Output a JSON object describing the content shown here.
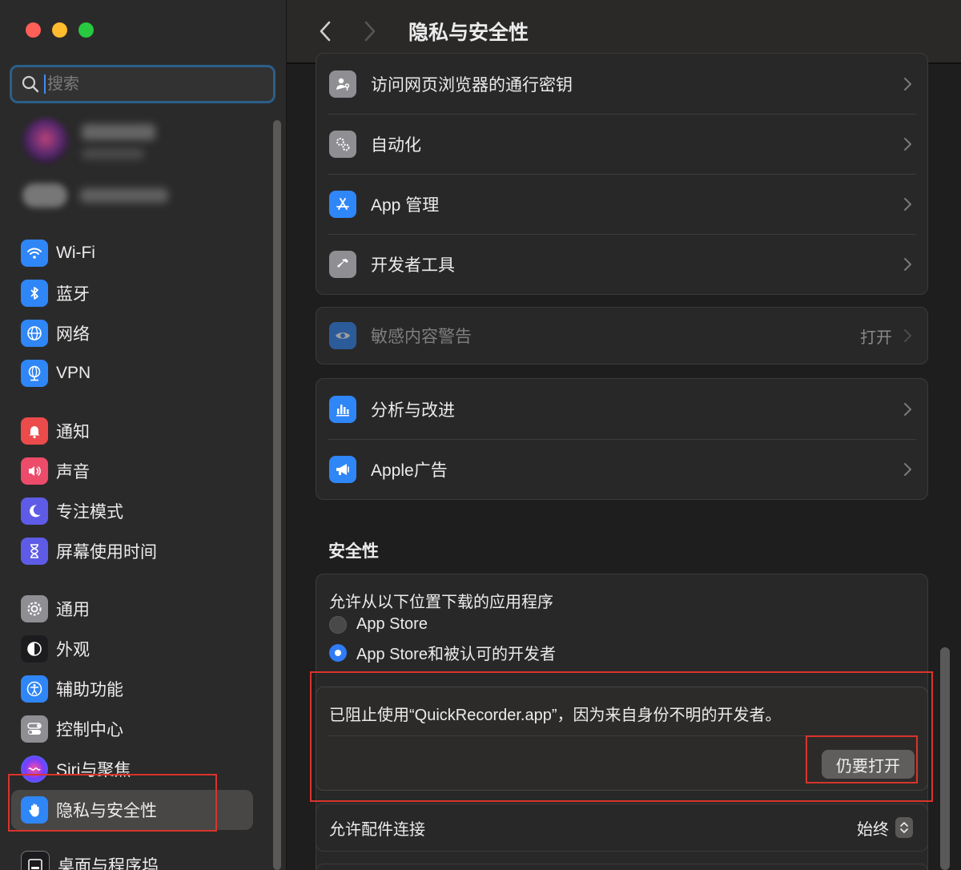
{
  "window": {
    "traffic_lights": {
      "close": "#ff5f57",
      "minimize": "#febc2e",
      "maximize": "#28c840"
    }
  },
  "sidebar": {
    "search": {
      "placeholder": "搜索",
      "icon": "magnifying-glass-icon"
    },
    "items": [
      {
        "label": "Wi-Fi",
        "icon": "wifi-icon",
        "color": "#2f86f6"
      },
      {
        "label": "蓝牙",
        "icon": "bluetooth-icon",
        "color": "#2f86f6"
      },
      {
        "label": "网络",
        "icon": "globe-icon",
        "color": "#2f86f6"
      },
      {
        "label": "VPN",
        "icon": "vpn-globe-icon",
        "color": "#2f86f6"
      },
      {
        "label": "通知",
        "icon": "bell-icon",
        "color": "#ec4b4b"
      },
      {
        "label": "声音",
        "icon": "speaker-icon",
        "color": "#ec4b6a"
      },
      {
        "label": "专注模式",
        "icon": "moon-icon",
        "color": "#5e5ce6"
      },
      {
        "label": "屏幕使用时间",
        "icon": "hourglass-icon",
        "color": "#5e5ce6"
      },
      {
        "label": "通用",
        "icon": "gear-icon",
        "color": "#8e8e93"
      },
      {
        "label": "外观",
        "icon": "appearance-icon",
        "color": "#1c1c1e"
      },
      {
        "label": "辅助功能",
        "icon": "accessibility-icon",
        "color": "#2f86f6"
      },
      {
        "label": "控制中心",
        "icon": "toggles-icon",
        "color": "#8e8e93"
      },
      {
        "label": "Siri与聚焦",
        "icon": "siri-icon",
        "color": "#7a3cff"
      },
      {
        "label": "隐私与安全性",
        "icon": "hand-icon",
        "color": "#2f86f6",
        "selected": true
      },
      {
        "label": "桌面与程序坞",
        "icon": "dock-icon",
        "color": "#1c1c1e"
      }
    ]
  },
  "main": {
    "title": "隐私与安全性",
    "group1": [
      {
        "label": "访问网页浏览器的通行密钥",
        "icon": "person-key-icon",
        "color": "#8e8e93"
      },
      {
        "label": "自动化",
        "icon": "gears-icon",
        "color": "#8e8e93"
      },
      {
        "label": "App 管理",
        "icon": "app-store-icon",
        "color": "#2f86f6"
      },
      {
        "label": "开发者工具",
        "icon": "hammer-icon",
        "color": "#8e8e93"
      }
    ],
    "group2": [
      {
        "label": "敏感内容警告",
        "icon": "eye-icon",
        "color": "#2f86f6",
        "value": "打开"
      }
    ],
    "group3": [
      {
        "label": "分析与改进",
        "icon": "bar-chart-icon",
        "color": "#2f86f6"
      },
      {
        "label": "Apple广告",
        "icon": "megaphone-icon",
        "color": "#2f86f6"
      }
    ],
    "security": {
      "heading": "安全性",
      "allow_caption": "允许从以下位置下载的应用程序",
      "options": [
        {
          "label": "App Store",
          "selected": false
        },
        {
          "label": "App Store和被认可的开发者",
          "selected": true
        }
      ],
      "blocked_message": "已阻止使用“QuickRecorder.app”，因为来自身份不明的开发者。",
      "open_anyway": "仍要打开",
      "accessory_label": "允许配件连接",
      "accessory_value": "始终"
    }
  },
  "annotation_color": "#d9342b"
}
